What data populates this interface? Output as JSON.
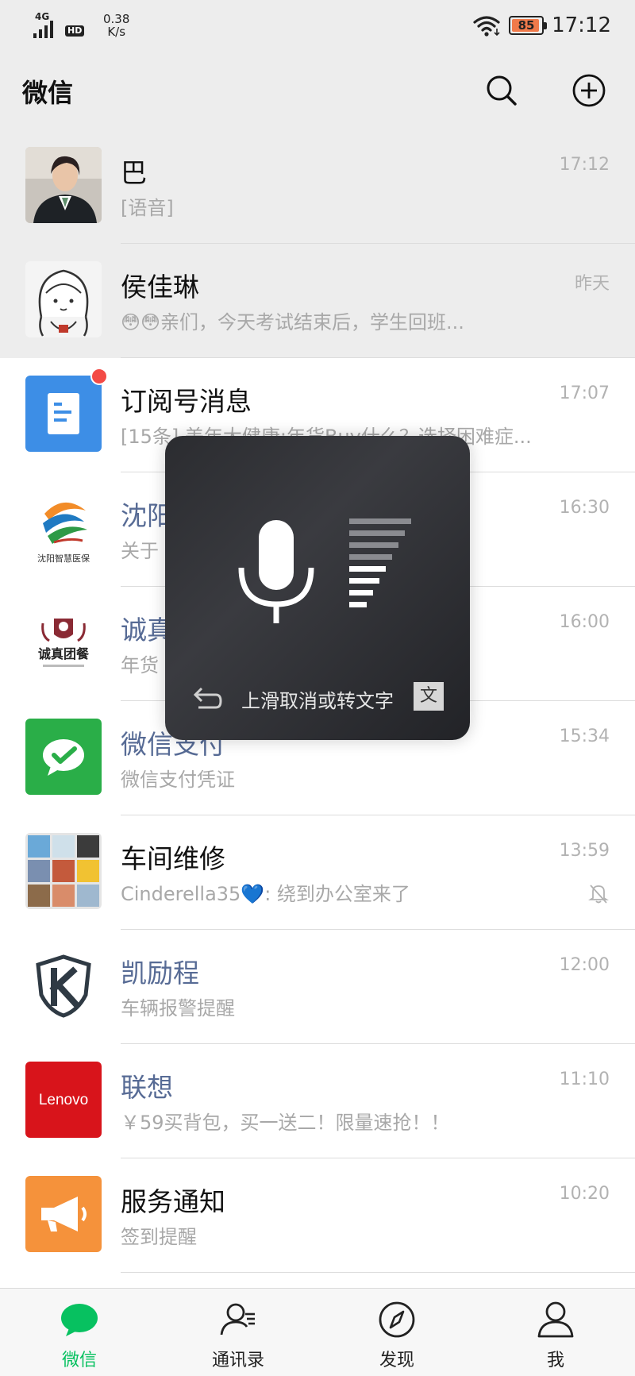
{
  "status_bar": {
    "network": "4G",
    "hd": "HD",
    "speed_value": "0.38",
    "speed_unit": "K/s",
    "battery": "85",
    "time": "17:12"
  },
  "header": {
    "title": "微信",
    "icons": [
      "search-icon",
      "add-circle-icon"
    ]
  },
  "chats": [
    {
      "name": "巴",
      "preview": "[语音]",
      "time": "17:12",
      "pinned": true
    },
    {
      "name": "侯佳琳",
      "preview": "亲们，今天考试结束后，学生回班...",
      "emoji": "😳😳",
      "time": "昨天",
      "pinned": true
    },
    {
      "name": "订阅号消息",
      "preview": "[15条] 美年大健康:年货Buy什么？选择困难症...",
      "time": "17:07",
      "unread_dot": true
    },
    {
      "name": "沈阳智慧医保",
      "preview": "关于",
      "time": "16:30",
      "logo_text": "沈阳智慧医保"
    },
    {
      "name": "诚真团餐",
      "preview": "年货",
      "time": "16:00",
      "logo_text": "诚真团餐"
    },
    {
      "name": "微信支付",
      "preview": "微信支付凭证",
      "time": "15:34"
    },
    {
      "name": "车间维修",
      "preview": "Cinderella35💙: 绕到办公室来了",
      "time": "13:59",
      "muted": true
    },
    {
      "name": "凯励程",
      "preview": "车辆报警提醒",
      "time": "12:00"
    },
    {
      "name": "联想",
      "preview": "￥59买背包，买一送二！限量速抢！！",
      "time": "11:10",
      "logo_text": "Lenovo"
    },
    {
      "name": "服务通知",
      "preview": "签到提醒",
      "time": "10:20"
    }
  ],
  "voice_overlay": {
    "hint": "上滑取消或转文字",
    "convert_label": "文"
  },
  "tabs": [
    {
      "label": "微信",
      "icon": "chat-bubble-icon",
      "active": true
    },
    {
      "label": "通讯录",
      "icon": "contacts-icon"
    },
    {
      "label": "发现",
      "icon": "compass-icon"
    },
    {
      "label": "我",
      "icon": "person-icon"
    }
  ],
  "colors": {
    "accent": "#07c160",
    "official_name": "#576b95",
    "unread": "#f34b46",
    "battery_fill": "#f07a4a"
  }
}
